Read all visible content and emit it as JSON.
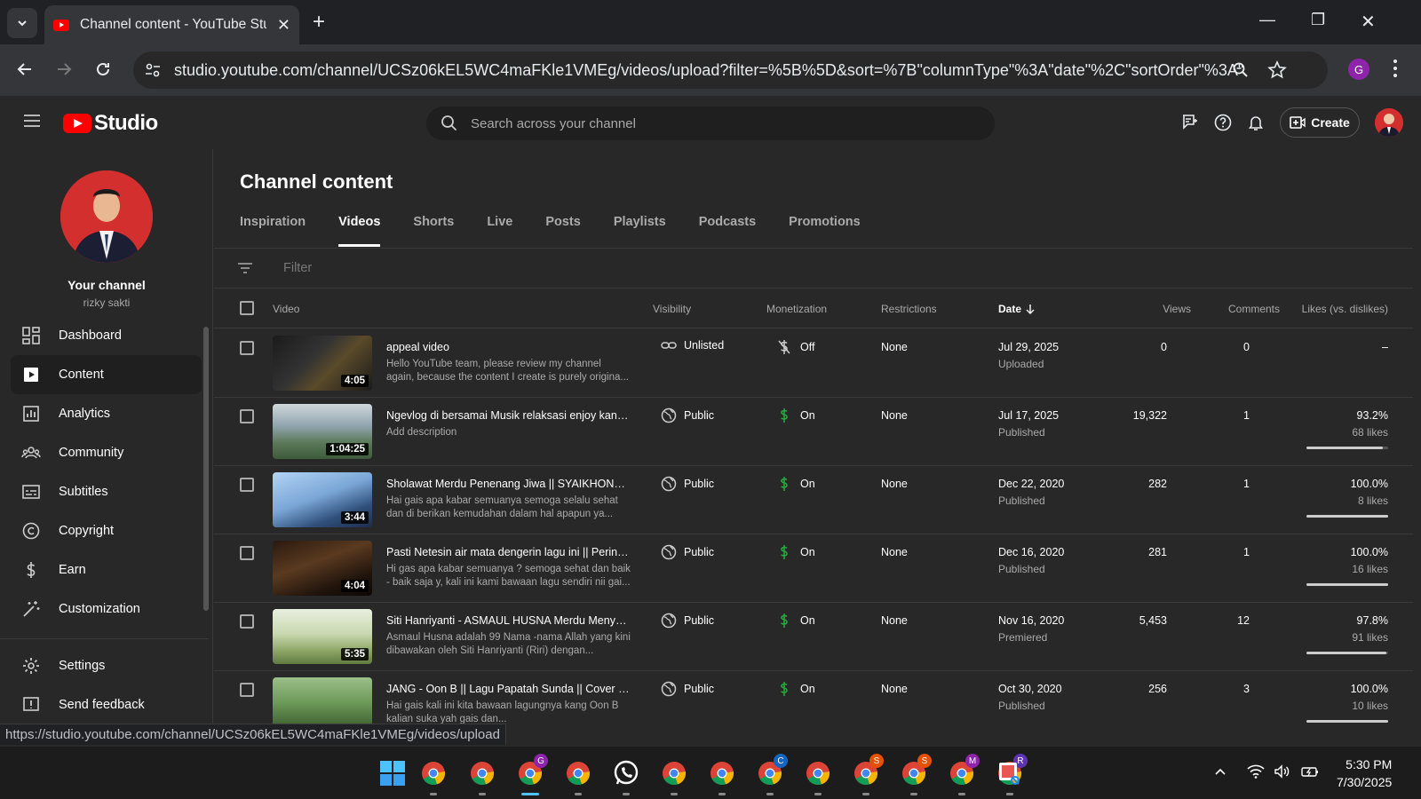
{
  "browser": {
    "tab_title": "Channel content - YouTube Studio",
    "url": "studio.youtube.com/channel/UCSz06kEL5WC4maFKle1VMEg/videos/upload?filter=%5B%5D&sort=%7B\"columnType\"%3A\"date\"%2C\"sortOrder\"%3A\"DESCENDING\"%7D",
    "profile_initial": "G",
    "status_url": "https://studio.youtube.com/channel/UCSz06kEL5WC4maFKle1VMEg/videos/upload"
  },
  "header": {
    "logo_text": "Studio",
    "search_placeholder": "Search across your channel",
    "create_label": "Create"
  },
  "sidebar": {
    "channel_name": "Your channel",
    "channel_handle": "rizky sakti",
    "items": [
      {
        "label": "Dashboard",
        "icon": "dashboard-icon"
      },
      {
        "label": "Content",
        "icon": "content-icon"
      },
      {
        "label": "Analytics",
        "icon": "analytics-icon"
      },
      {
        "label": "Community",
        "icon": "community-icon"
      },
      {
        "label": "Subtitles",
        "icon": "subtitles-icon"
      },
      {
        "label": "Copyright",
        "icon": "copyright-icon"
      },
      {
        "label": "Earn",
        "icon": "earn-icon"
      },
      {
        "label": "Customization",
        "icon": "customization-icon"
      },
      {
        "label": "Settings",
        "icon": "settings-icon"
      },
      {
        "label": "Send feedback",
        "icon": "feedback-icon"
      }
    ]
  },
  "main": {
    "title": "Channel content",
    "tabs": [
      "Inspiration",
      "Videos",
      "Shorts",
      "Live",
      "Posts",
      "Playlists",
      "Podcasts",
      "Promotions"
    ],
    "active_tab": "Videos",
    "filter_placeholder": "Filter",
    "columns": {
      "video": "Video",
      "visibility": "Visibility",
      "monetization": "Monetization",
      "restrictions": "Restrictions",
      "date": "Date",
      "views": "Views",
      "comments": "Comments",
      "likes": "Likes (vs. dislikes)"
    },
    "rows": [
      {
        "title": "appeal video",
        "desc": "Hello YouTube team, please review my channel again, because the content I create is purely origina...",
        "duration": "4:05",
        "visibility": "Unlisted",
        "monetization": "Off",
        "restrictions": "None",
        "date": "Jul 29, 2025",
        "date_status": "Uploaded",
        "views": "0",
        "comments": "0",
        "likes_pct": "–",
        "likes_count": "",
        "like_ratio": 0
      },
      {
        "title": "Ngevlog di bersamai Musik relaksasi enjoy kan k...",
        "desc": "Add description",
        "duration": "1:04:25",
        "visibility": "Public",
        "monetization": "On",
        "restrictions": "None",
        "date": "Jul 17, 2025",
        "date_status": "Published",
        "views": "19,322",
        "comments": "1",
        "likes_pct": "93.2%",
        "likes_count": "68 likes",
        "like_ratio": 0.932
      },
      {
        "title": "Sholawat Merdu Penenang Jiwa || SYAIKHONA ( ...",
        "desc": "Hai gais apa kabar semuanya semoga selalu sehat dan di berikan kemudahan dalam hal apapun ya...",
        "duration": "3:44",
        "visibility": "Public",
        "monetization": "On",
        "restrictions": "None",
        "date": "Dec 22, 2020",
        "date_status": "Published",
        "views": "282",
        "comments": "1",
        "likes_pct": "100.0%",
        "likes_count": "8 likes",
        "like_ratio": 1.0
      },
      {
        "title": "Pasti Netesin air mata dengerin lagu ini || Pering...",
        "desc": "Hi gas apa kabar semuanya ? semoga sehat dan baik - baik saja y, kali ini kami bawaan lagu sendiri nii gai...",
        "duration": "4:04",
        "visibility": "Public",
        "monetization": "On",
        "restrictions": "None",
        "date": "Dec 16, 2020",
        "date_status": "Published",
        "views": "281",
        "comments": "1",
        "likes_pct": "100.0%",
        "likes_count": "16 likes",
        "like_ratio": 1.0
      },
      {
        "title": "Siti Hanriyanti - ASMAUL HUSNA Merdu Menyen...",
        "desc": "Asmaul Husna adalah 99 Nama -nama Allah yang kini dibawakan oleh Siti Hanriyanti (Riri) dengan...",
        "duration": "5:35",
        "visibility": "Public",
        "monetization": "On",
        "restrictions": "None",
        "date": "Nov 16, 2020",
        "date_status": "Premiered",
        "views": "5,453",
        "comments": "12",
        "likes_pct": "97.8%",
        "likes_count": "91 likes",
        "like_ratio": 0.978
      },
      {
        "title": "JANG - Oon B || Lagu Papatah Sunda || Cover MA...",
        "desc": "Hai gais kali ini kita bawaan lagungnya kang Oon B kalian suka yah gais dan...",
        "duration": "",
        "visibility": "Public",
        "monetization": "On",
        "restrictions": "None",
        "date": "Oct 30, 2020",
        "date_status": "Published",
        "views": "256",
        "comments": "3",
        "likes_pct": "100.0%",
        "likes_count": "10 likes",
        "like_ratio": 1.0
      }
    ]
  },
  "taskbar": {
    "time": "5:30 PM",
    "date": "7/30/2025",
    "chrome_badges": [
      "",
      "",
      "G",
      "",
      "",
      "",
      "C",
      "",
      "S",
      "S",
      "M",
      "R"
    ]
  }
}
